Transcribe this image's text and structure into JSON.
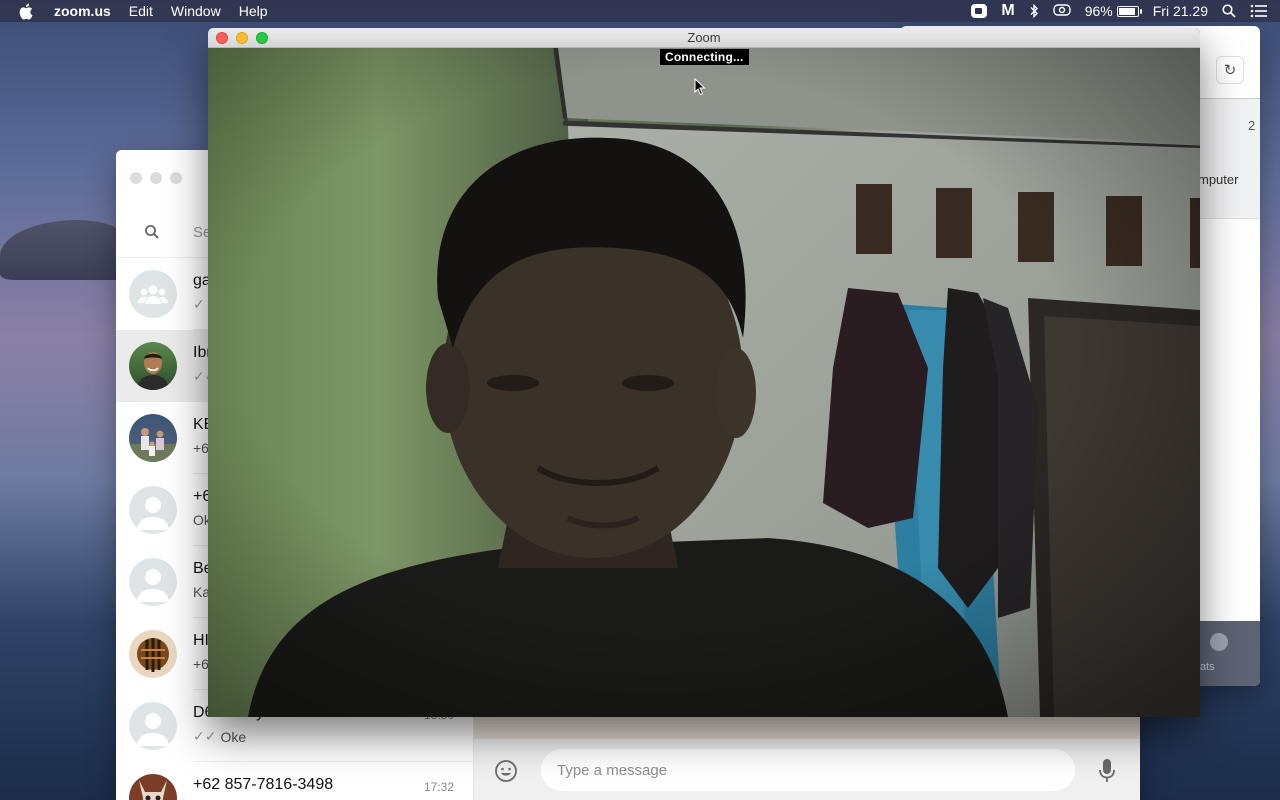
{
  "menubar": {
    "app_name": "zoom.us",
    "menus": [
      "Edit",
      "Window",
      "Help"
    ],
    "battery_percent": "96%",
    "battery_level": 0.96,
    "clock": "Fri 21.29",
    "status_icons": [
      "zoom-camera-icon",
      "m-icon",
      "bluetooth-icon",
      "screen-mirror-icon",
      "battery-icon",
      "spotlight-search-icon",
      "notification-center-icon"
    ]
  },
  "zoom_window": {
    "title": "Zoom",
    "status": "Connecting..."
  },
  "back_window": {
    "number_fragment": "2",
    "text_fragment": "mputer",
    "chats_label_fragment": "ats"
  },
  "whatsapp": {
    "search_placeholder": "Se",
    "chats": [
      {
        "name": "ga",
        "sub": "",
        "time": "",
        "avatar": "group-avatar-icon",
        "ticks": "✓"
      },
      {
        "name": "Ibr",
        "sub": "",
        "time": "",
        "avatar": "photo",
        "ticks": "✓✓"
      },
      {
        "name": "KE",
        "sub": "+6",
        "time": "",
        "avatar": "photo",
        "ticks": ""
      },
      {
        "name": "+6",
        "sub": "Ok",
        "time": "",
        "avatar": "default-avatar-icon",
        "ticks": ""
      },
      {
        "name": "Be",
        "sub": "Ka",
        "time": "",
        "avatar": "default-avatar-icon",
        "ticks": ""
      },
      {
        "name": "HI",
        "sub": "+6",
        "time": "",
        "avatar": "photo",
        "ticks": ""
      },
      {
        "name": "D6 Denny",
        "sub": "Oke",
        "time": "18:50",
        "avatar": "default-avatar-icon",
        "ticks": "✓✓"
      },
      {
        "name": "+62 857-7816-3498",
        "sub": "",
        "time": "17:32",
        "avatar": "photo",
        "ticks": ""
      }
    ],
    "composer": {
      "placeholder": "Type a message"
    }
  }
}
